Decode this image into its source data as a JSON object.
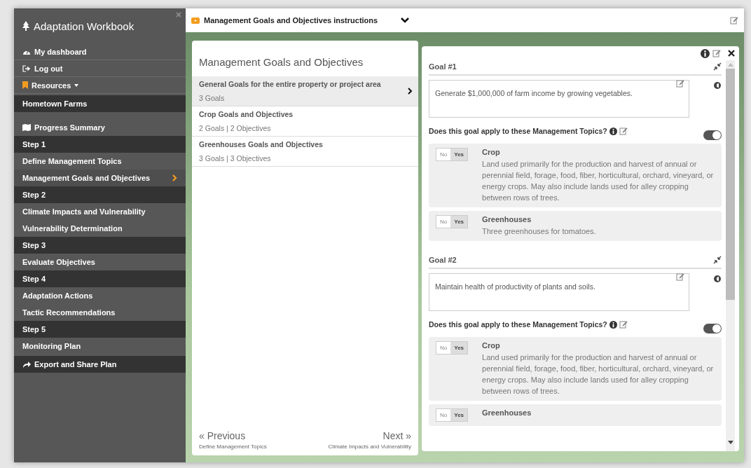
{
  "sidebar": {
    "title": "Adaptation Workbook",
    "links": [
      {
        "label": "My dashboard"
      },
      {
        "label": "Log out"
      },
      {
        "label": "Resources"
      }
    ],
    "project": "Hometown Farms",
    "summary": "Progress Summary",
    "steps": [
      {
        "label": "Step 1",
        "pages": [
          {
            "label": "Define Management Topics",
            "selected": false
          },
          {
            "label": "Management Goals and Objectives",
            "selected": true
          }
        ]
      },
      {
        "label": "Step 2",
        "pages": [
          {
            "label": "Climate Impacts and Vulnerability",
            "selected": false
          },
          {
            "label": "Vulnerability Determination",
            "selected": false
          }
        ]
      },
      {
        "label": "Step 3",
        "pages": [
          {
            "label": "Evaluate Objectives",
            "selected": false
          }
        ]
      },
      {
        "label": "Step 4",
        "pages": [
          {
            "label": "Adaptation Actions",
            "selected": false
          },
          {
            "label": "Tactic Recommendations",
            "selected": false
          }
        ]
      },
      {
        "label": "Step 5",
        "pages": [
          {
            "label": "Monitoring Plan",
            "selected": false
          }
        ]
      }
    ],
    "export": "Export and Share Plan"
  },
  "topbar": {
    "title": "Management Goals and Objectives instructions"
  },
  "list_panel": {
    "title": "Management Goals and Objectives",
    "items": [
      {
        "title": "General Goals for the entire property or project area",
        "summary": "3 Goals",
        "selected": true
      },
      {
        "title": "Crop Goals and Objectives",
        "summary": "2 Goals | 2 Objectives",
        "selected": false
      },
      {
        "title": "Greenhouses Goals and Objectives",
        "summary": "3 Goals | 3 Objectives",
        "selected": false
      }
    ],
    "previous": {
      "label": "« Previous",
      "page": "Define Management Topics"
    },
    "next": {
      "label": "Next »",
      "page": "Climate Impacts and Vulnerability"
    }
  },
  "goals": [
    {
      "title": "Goal #1",
      "text": "Generate $1,000,000 of farm income by growing vegetables.",
      "question": "Does this goal apply to these Management Topics?",
      "on": true,
      "topics": [
        {
          "name": "Crop",
          "description": "Land used primarily for the production and harvest of annual or perennial field, forage, food, fiber, horticultural, orchard, vineyard, or energy crops. May also include lands used for alley cropping between rows of trees.",
          "options": [
            {
              "label": "No",
              "selected": false
            },
            {
              "label": "Yes",
              "selected": true
            }
          ]
        },
        {
          "name": "Greenhouses",
          "description": "Three greenhouses for tomatoes.",
          "options": [
            {
              "label": "No",
              "selected": false
            },
            {
              "label": "Yes",
              "selected": true
            }
          ]
        }
      ]
    },
    {
      "title": "Goal #2",
      "text": "Maintain health of productivity of plants and soils.",
      "question": "Does this goal apply to these Management Topics?",
      "on": true,
      "topics": [
        {
          "name": "Crop",
          "description": "Land used primarily for the production and harvest of annual or perennial field, forage, food, fiber, horticultural, orchard, vineyard, or energy crops. May also include lands used for alley cropping between rows of trees.",
          "options": [
            {
              "label": "No",
              "selected": false
            },
            {
              "label": "Yes",
              "selected": true
            }
          ]
        },
        {
          "name": "Greenhouses",
          "options": [
            {
              "label": "No",
              "selected": false
            },
            {
              "label": "Yes",
              "selected": true
            }
          ]
        }
      ]
    }
  ]
}
